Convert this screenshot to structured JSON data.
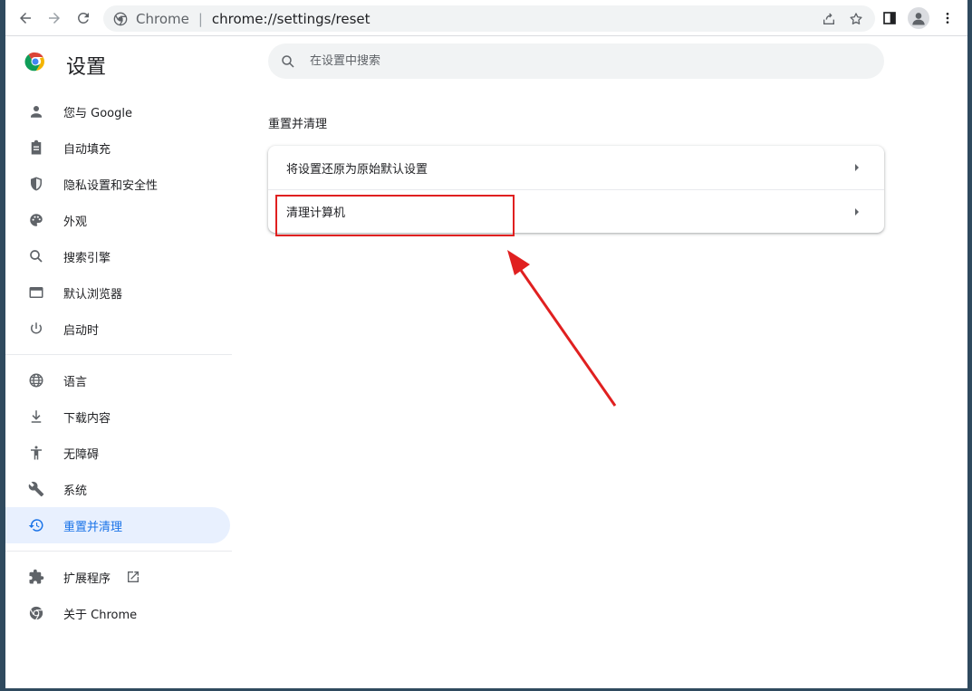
{
  "browser": {
    "site_name": "Chrome",
    "url": "chrome://settings/reset"
  },
  "header": {
    "title": "设置",
    "search_placeholder": "在设置中搜索"
  },
  "sidebar": {
    "items": [
      {
        "label": "您与 Google",
        "icon": "person-icon"
      },
      {
        "label": "自动填充",
        "icon": "clipboard-icon"
      },
      {
        "label": "隐私设置和安全性",
        "icon": "shield-icon"
      },
      {
        "label": "外观",
        "icon": "palette-icon"
      },
      {
        "label": "搜索引擎",
        "icon": "search-icon"
      },
      {
        "label": "默认浏览器",
        "icon": "browser-window-icon"
      },
      {
        "label": "启动时",
        "icon": "power-icon"
      },
      {
        "label": "语言",
        "icon": "globe-icon"
      },
      {
        "label": "下载内容",
        "icon": "download-icon"
      },
      {
        "label": "无障碍",
        "icon": "accessibility-icon"
      },
      {
        "label": "系统",
        "icon": "wrench-icon"
      },
      {
        "label": "重置并清理",
        "icon": "restore-icon",
        "active": true
      },
      {
        "label": "扩展程序",
        "icon": "puzzle-icon"
      },
      {
        "label": "关于 Chrome",
        "icon": "chrome-icon"
      }
    ]
  },
  "main": {
    "section_title": "重置并清理",
    "rows": [
      {
        "label": "将设置还原为原始默认设置"
      },
      {
        "label": "清理计算机"
      }
    ]
  },
  "colors": {
    "accent": "#1a73e8",
    "active_bg": "#e8f0fe",
    "annotation": "#e02020",
    "icon": "#5f6368"
  }
}
